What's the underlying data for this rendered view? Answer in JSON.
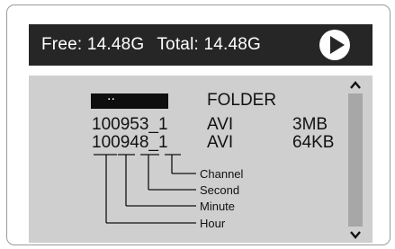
{
  "status_bar": {
    "free": "Free: 14.48G",
    "total": "Total: 14.48G",
    "play_icon": "play-icon"
  },
  "file_list": {
    "parent_entry": "..",
    "folder_label": "FOLDER",
    "rows": [
      {
        "name": "100953_1",
        "type": "AVI",
        "size": "3MB"
      },
      {
        "name": "100948_1",
        "type": "AVI",
        "size": "64KB"
      }
    ]
  },
  "filename_legend": {
    "channel": "Channel",
    "second": "Second",
    "minute": "Minute",
    "hour": "Hour"
  },
  "scrollbar": {
    "up_icon": "arrow-up-icon",
    "down_icon": "arrow-down-icon"
  },
  "colors": {
    "header_bg": "#262626",
    "panel_bg": "#cfcfcf",
    "scroll_track": "#a7a7a7",
    "selection": "#0e0e0e"
  }
}
